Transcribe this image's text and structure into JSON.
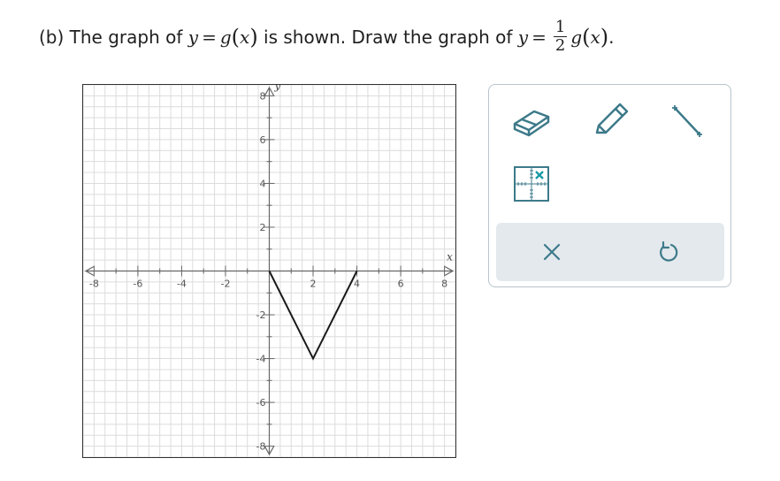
{
  "question": {
    "prefix": "(b) The graph of",
    "y1": "y",
    "eq1": "=",
    "g1": "g",
    "x1": "x",
    "middle": "is shown. Draw the graph of",
    "y2": "y",
    "eq2": "=",
    "frac_num": "1",
    "frac_den": "2",
    "g2": "g",
    "x2": "x",
    "end": "."
  },
  "graph": {
    "x_axis_label": "x",
    "y_axis_label": "y",
    "x_tick_labels": [
      "-8",
      "-6",
      "-4",
      "-2",
      "2",
      "4",
      "6",
      "8"
    ],
    "y_tick_labels": [
      "8",
      "6",
      "4",
      "2",
      "-2",
      "-4",
      "-6",
      "-8"
    ],
    "x_range": [
      -8.5,
      8.5
    ],
    "y_range": [
      -8.5,
      8.5
    ],
    "grid": true,
    "curve_color": "#1a1a1a",
    "curve_points": [
      [
        0,
        0
      ],
      [
        2,
        -4
      ],
      [
        4,
        0
      ]
    ]
  },
  "tools": {
    "eraser": "eraser-icon",
    "pencil": "pencil-icon",
    "line": "line-segment-icon",
    "point": "point-grid-icon",
    "clear": "clear-x-icon",
    "undo": "undo-icon",
    "accent_color": "#3d7a8a",
    "point_accent": "#1a9aa6"
  }
}
